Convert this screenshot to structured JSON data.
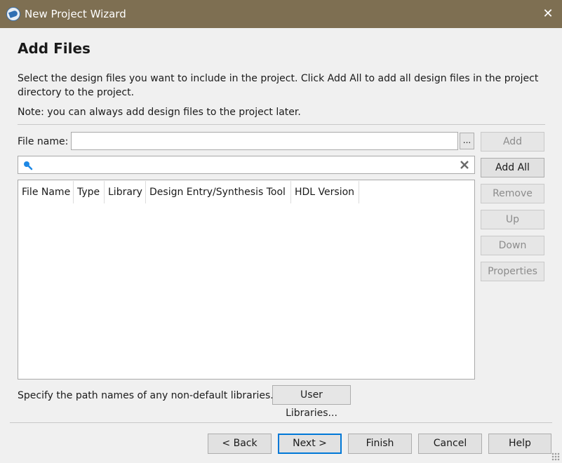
{
  "window": {
    "title": "New Project Wizard",
    "close_glyph": "✕"
  },
  "page": {
    "heading": "Add Files",
    "description": "Select the design files you want to include in the project. Click Add All to add all design files in the project directory to the project.",
    "note": "Note: you can always add design files to the project later."
  },
  "file_name": {
    "label": "File name:",
    "value": "",
    "browse_label": "..."
  },
  "filter": {
    "value": "",
    "search_icon": "search-icon",
    "clear_icon": "clear-icon"
  },
  "file_table": {
    "columns": [
      "File Name",
      "Type",
      "Library",
      "Design Entry/Synthesis Tool",
      "HDL Version"
    ],
    "rows": []
  },
  "side_buttons": {
    "add": "Add",
    "add_all": "Add All",
    "remove": "Remove",
    "up": "Up",
    "down": "Down",
    "properties": "Properties"
  },
  "libraries": {
    "text": "Specify the path names of any non-default libraries.",
    "button": "User Libraries..."
  },
  "footer": {
    "back": "< Back",
    "next": "Next >",
    "finish": "Finish",
    "cancel": "Cancel",
    "help": "Help"
  },
  "colors": {
    "titlebar": "#7e6f52",
    "accent": "#0078d7",
    "search_icon": "#1e88e5"
  }
}
